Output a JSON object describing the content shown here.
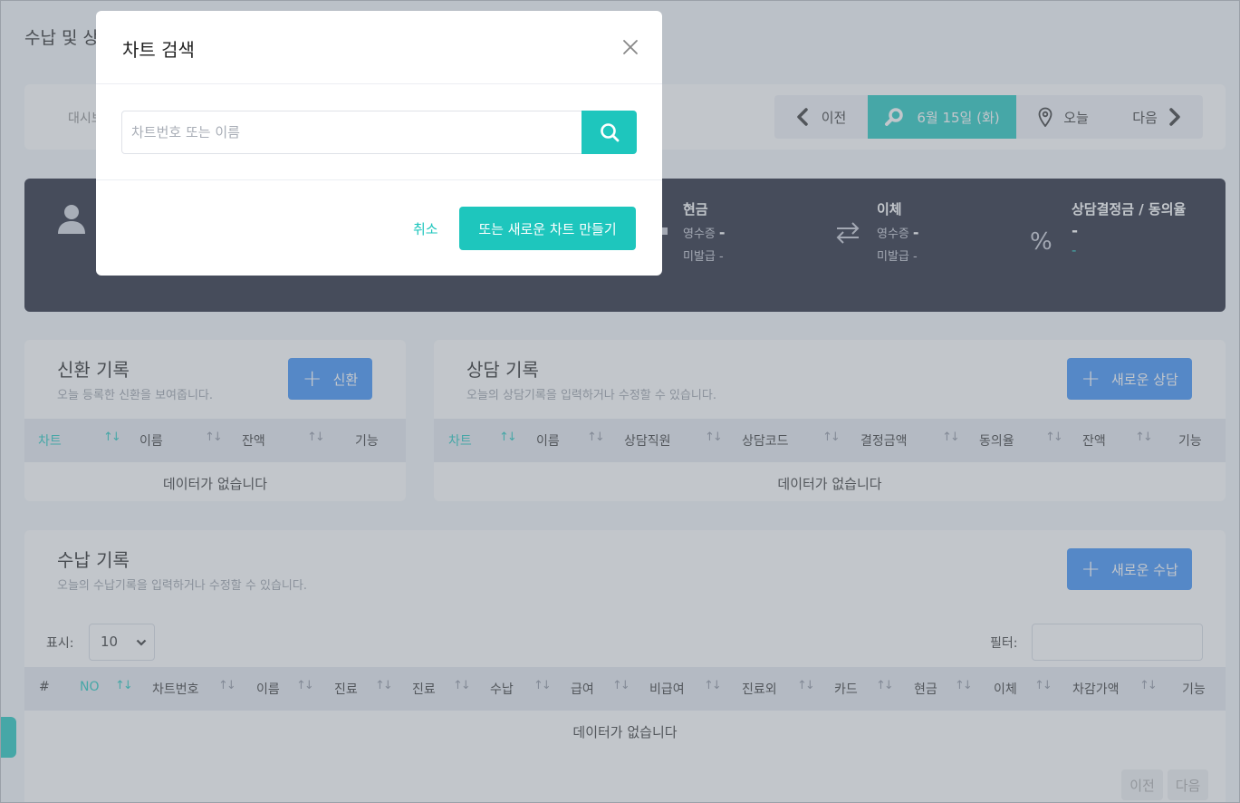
{
  "page": {
    "title": "수납 및 상담"
  },
  "nav": {
    "dashboard": "대시보드",
    "prev": "이전",
    "current_date": "6월 15일 (화)",
    "today": "오늘",
    "next": "다음"
  },
  "summary": {
    "cash": {
      "title": "현금",
      "receipt_label": "영수증",
      "receipt_value": "-",
      "unissued_label": "미발급",
      "unissued_value": "-"
    },
    "transfer": {
      "title": "이체",
      "receipt_label": "영수증",
      "receipt_value": "-",
      "unissued_label": "미발급",
      "unissued_value": "-"
    },
    "consult_rate": {
      "title": "상담결정금 / 동의율",
      "value": "-",
      "sub_value": "-",
      "sub_color": "#1ec6bd",
      "icon": "%"
    }
  },
  "renewal": {
    "title": "신환 기록",
    "subtitle": "오늘 등록한 신환을 보여줍니다.",
    "add_button": "신환",
    "columns": [
      "차트",
      "이름",
      "잔액",
      "기능"
    ],
    "empty": "데이터가 없습니다"
  },
  "consult": {
    "title": "상담 기록",
    "subtitle": "오늘의 상담기록을 입력하거나 수정할 수 있습니다.",
    "add_button": "새로운 상담",
    "columns": [
      "차트",
      "이름",
      "상담직원",
      "상담코드",
      "결정금액",
      "동의율",
      "잔액",
      "기능"
    ],
    "empty": "데이터가 없습니다"
  },
  "payment": {
    "title": "수납 기록",
    "subtitle": "오늘의 수납기록을 입력하거나 수정할 수 있습니다.",
    "add_button": "새로운 수납",
    "show_label": "표시:",
    "page_size": "10",
    "filter_label": "필터:",
    "columns": [
      "#",
      "NO",
      "차트번호",
      "이름",
      "진료",
      "진료",
      "수납",
      "급여",
      "비급여",
      "진료외",
      "카드",
      "현금",
      "이체",
      "차감가액",
      "기능"
    ],
    "empty": "데이터가 없습니다",
    "prev": "이전",
    "next": "다음"
  },
  "modal": {
    "title": "차트 검색",
    "search_placeholder": "차트번호 또는 이름",
    "cancel": "취소",
    "new_chart": "또는 새로운 차트 만들기"
  },
  "colors": {
    "accent": "#1ec6bd",
    "primary": "#3a8ff7",
    "dark": "#1e2234"
  }
}
